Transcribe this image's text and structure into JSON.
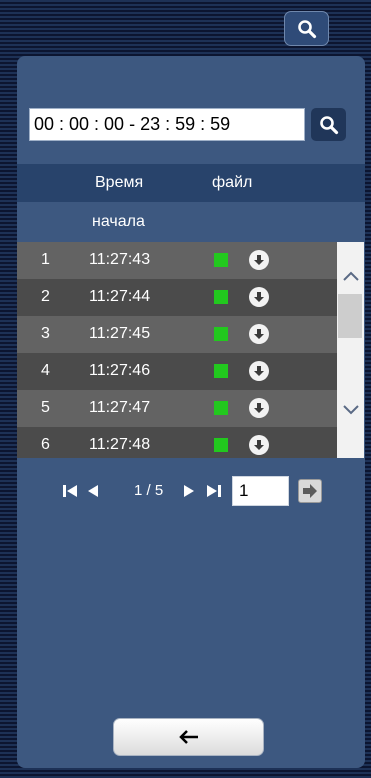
{
  "search": {
    "time_range": "00 : 00 : 00 - 23 : 59 : 59",
    "top_icon": "search-icon",
    "query_icon": "search-icon"
  },
  "table": {
    "headers": {
      "start_time_line1": "Время",
      "start_time_line2": "начала",
      "file": "файл"
    },
    "rows": [
      {
        "num": "1",
        "time": "11:27:43"
      },
      {
        "num": "2",
        "time": "11:27:44"
      },
      {
        "num": "3",
        "time": "11:27:45"
      },
      {
        "num": "4",
        "time": "11:27:46"
      },
      {
        "num": "5",
        "time": "11:27:47"
      },
      {
        "num": "6",
        "time": "11:27:48"
      }
    ],
    "status_color": "#22c81e",
    "download_icon": "download-icon"
  },
  "pagination": {
    "label": "1 / 5",
    "page_input": "1"
  },
  "colors": {
    "panel": "#3d5880",
    "header_band": "#28436b"
  }
}
